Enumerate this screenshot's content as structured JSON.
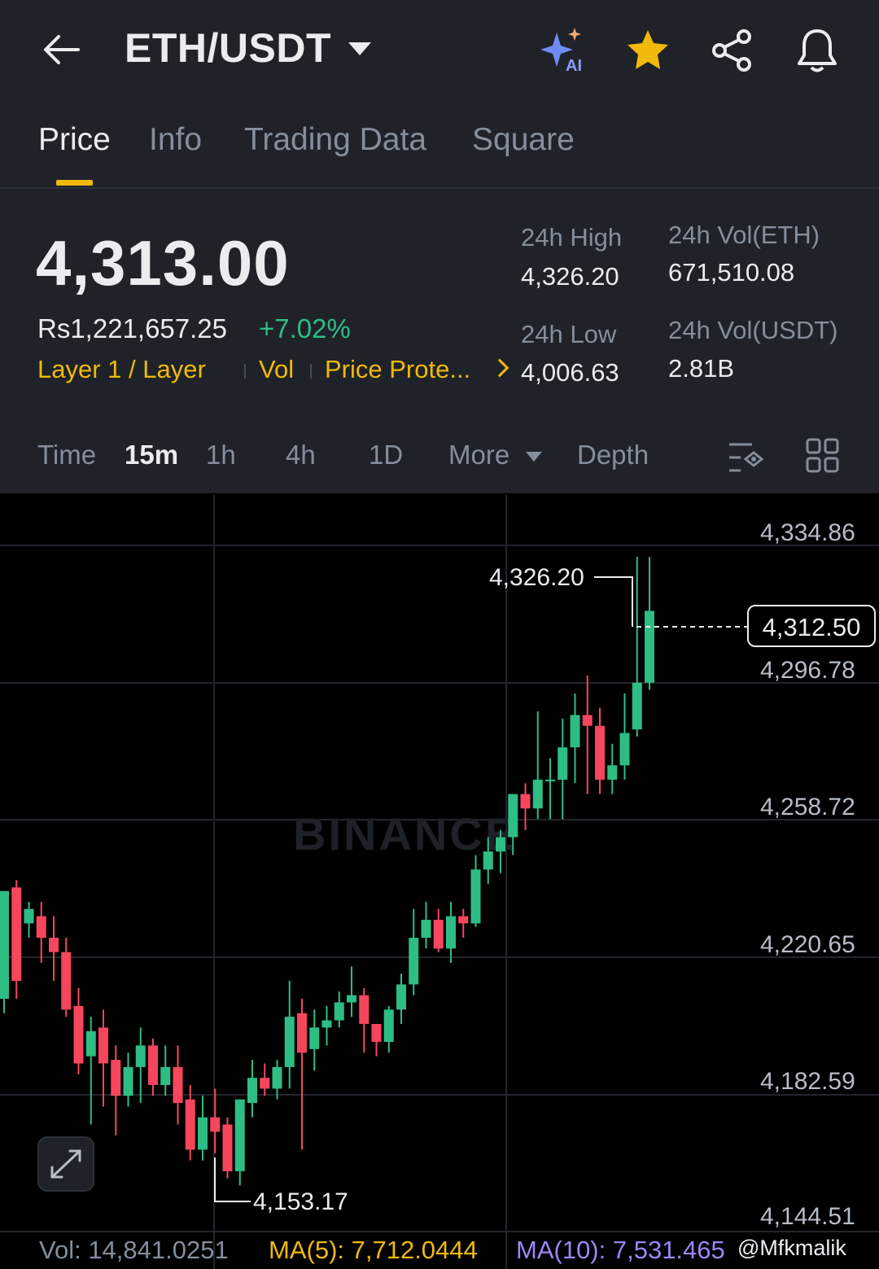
{
  "header": {
    "pair": "ETH/USDT",
    "icons": [
      "back-arrow-icon",
      "ai-sparkle-icon",
      "star-icon",
      "share-icon",
      "bell-icon"
    ],
    "ai_badge": "AI"
  },
  "tabs": [
    {
      "label": "Price",
      "active": true
    },
    {
      "label": "Info"
    },
    {
      "label": "Trading Data"
    },
    {
      "label": "Square"
    }
  ],
  "ticker": {
    "last_price": "4,313.00",
    "fiat_price": "Rs1,221,657.25",
    "change_pct": "+7.02%",
    "tag1": "Layer 1 / Layer",
    "tag2": "Vol",
    "tag3": "Price Prote...",
    "high_label": "24h High",
    "high_value": "4,326.20",
    "low_label": "24h Low",
    "low_value": "4,006.63",
    "vol_base_label": "24h Vol(ETH)",
    "vol_base_value": "671,510.08",
    "vol_quote_label": "24h Vol(USDT)",
    "vol_quote_value": "2.81B"
  },
  "timeframes": {
    "time": "Time",
    "m15": "15m",
    "h1": "1h",
    "h4": "4h",
    "d1": "1D",
    "more": "More",
    "depth": "Depth",
    "selected": "15m"
  },
  "chart": {
    "watermark": "BINANCE",
    "axis_labels": [
      "4,334.86",
      "4,296.78",
      "4,258.72",
      "4,220.65",
      "4,182.59",
      "4,144.51"
    ],
    "current_price": "4,312.50",
    "high_marker": "4,326.20",
    "low_marker": "4,153.17",
    "colors": {
      "up": "#2ebd85",
      "down": "#f6465d",
      "accent": "#f0b90b",
      "ma10": "#9c86f5"
    }
  },
  "chart_data": {
    "type": "candlestick",
    "title": "",
    "xlabel": "",
    "ylabel": "",
    "ylim": [
      4144.51,
      4334.86
    ],
    "y_ticks": [
      4334.86,
      4296.78,
      4258.72,
      4220.65,
      4182.59,
      4144.51
    ],
    "high": 4326.2,
    "low": 4153.17,
    "last": 4312.5,
    "candles": [
      [
        4205,
        4235,
        4201,
        4235
      ],
      [
        4236,
        4210,
        4205,
        4238
      ],
      [
        4226,
        4230,
        4222,
        4232
      ],
      [
        4228,
        4222,
        4215,
        4232
      ],
      [
        4222,
        4218,
        4210,
        4228
      ],
      [
        4218,
        4202,
        4200,
        4222
      ],
      [
        4203,
        4187,
        4184,
        4208
      ],
      [
        4189,
        4196,
        4170,
        4200
      ],
      [
        4197,
        4187,
        4175,
        4202
      ],
      [
        4188,
        4178,
        4167,
        4192
      ],
      [
        4178,
        4186,
        4175,
        4190
      ],
      [
        4186,
        4192,
        4176,
        4197
      ],
      [
        4192,
        4181,
        4178,
        4194
      ],
      [
        4181,
        4186,
        4178,
        4192
      ],
      [
        4186,
        4176,
        4170,
        4192
      ],
      [
        4177,
        4163,
        4160,
        4181
      ],
      [
        4163,
        4172,
        4160,
        4178
      ],
      [
        4172,
        4168,
        4162,
        4180
      ],
      [
        4170,
        4157,
        4155,
        4172
      ],
      [
        4157,
        4177,
        4153,
        4177
      ],
      [
        4176,
        4183,
        4172,
        4188
      ],
      [
        4183,
        4180,
        4178,
        4187
      ],
      [
        4180,
        4186,
        4177,
        4188
      ],
      [
        4186,
        4200,
        4180,
        4210
      ],
      [
        4201,
        4190,
        4163,
        4205
      ],
      [
        4191,
        4197,
        4185,
        4202
      ],
      [
        4197,
        4199,
        4192,
        4203
      ],
      [
        4199,
        4204,
        4197,
        4207
      ],
      [
        4204,
        4206,
        4200,
        4214
      ],
      [
        4206,
        4198,
        4190,
        4208
      ],
      [
        4198,
        4193,
        4189,
        4197
      ],
      [
        4193,
        4202,
        4190,
        4203
      ],
      [
        4202,
        4209,
        4198,
        4212
      ],
      [
        4209,
        4222,
        4206,
        4230
      ],
      [
        4222,
        4227,
        4219,
        4232
      ],
      [
        4227,
        4219,
        4218,
        4230
      ],
      [
        4219,
        4228,
        4215,
        4232
      ],
      [
        4228,
        4226,
        4222,
        4230
      ],
      [
        4226,
        4241,
        4225,
        4245
      ],
      [
        4241,
        4246,
        4237,
        4250
      ],
      [
        4246,
        4250,
        4240,
        4252
      ],
      [
        4250,
        4262,
        4245,
        4262
      ],
      [
        4262,
        4258,
        4252,
        4265
      ],
      [
        4258,
        4266,
        4255,
        4285
      ],
      [
        4266,
        4266,
        4255,
        4272
      ],
      [
        4266,
        4275,
        4255,
        4283
      ],
      [
        4275,
        4284,
        4265,
        4290
      ],
      [
        4284,
        4281,
        4262,
        4295
      ],
      [
        4281,
        4266,
        4262,
        4286
      ],
      [
        4266,
        4270,
        4262,
        4276
      ],
      [
        4270,
        4279,
        4266,
        4290
      ],
      [
        4280,
        4293,
        4278,
        4328
      ],
      [
        4293,
        4313,
        4291,
        4328
      ]
    ],
    "volume": "14,841.0251",
    "ma5": "7,712.0444",
    "ma10": "7,531.465"
  },
  "footer": {
    "vol": "Vol: 14,841.0251",
    "ma5": "MA(5): 7,712.0444",
    "ma10": "MA(10): 7,531.465",
    "user": "@Mfkmalik"
  }
}
